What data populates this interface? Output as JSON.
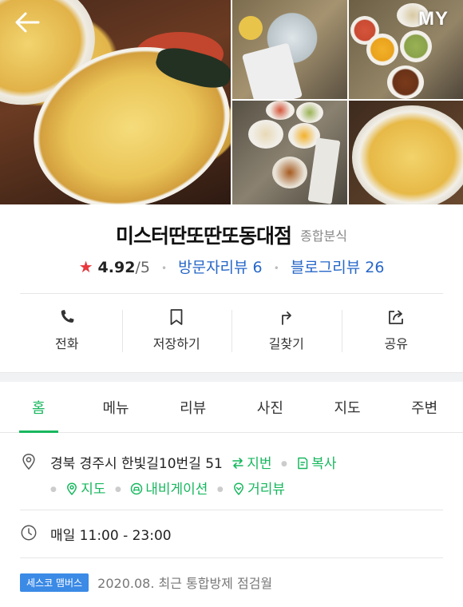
{
  "header": {
    "my_label": "MY"
  },
  "store": {
    "name": "미스터딴또딴또동대점",
    "category": "종합분식",
    "rating": "4.92",
    "rating_max": "/5",
    "visitor_reviews": "방문자리뷰 6",
    "blog_reviews": "블로그리뷰 26"
  },
  "actions": [
    {
      "label": "전화",
      "icon": "phone-icon"
    },
    {
      "label": "저장하기",
      "icon": "bookmark-icon"
    },
    {
      "label": "길찾기",
      "icon": "directions-icon"
    },
    {
      "label": "공유",
      "icon": "share-icon"
    }
  ],
  "tabs": [
    "홈",
    "메뉴",
    "리뷰",
    "사진",
    "지도",
    "주변"
  ],
  "active_tab": "홈",
  "address": {
    "text": "경북 경주시 한빛길10번길 51",
    "jibun": "지번",
    "copy": "복사",
    "map": "지도",
    "navigation": "내비게이션",
    "streetview": "거리뷰"
  },
  "hours": {
    "text": "매일 11:00 - 23:00"
  },
  "notice": {
    "badge": "세스코 맴버스",
    "text": "2020.08. 최근 통합방제 점검월"
  },
  "colors": {
    "accent": "#17b75e",
    "link": "#2767c8",
    "star": "#e8373d",
    "badge": "#3b8ae6"
  }
}
